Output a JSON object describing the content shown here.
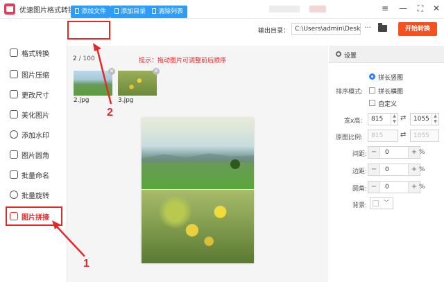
{
  "app": {
    "title": "优速图片格式转换器"
  },
  "sidebar": {
    "items": [
      {
        "label": "格式转换"
      },
      {
        "label": "图片压缩"
      },
      {
        "label": "更改尺寸"
      },
      {
        "label": "美化图片"
      },
      {
        "label": "添加水印"
      },
      {
        "label": "图片圆角"
      },
      {
        "label": "批量命名"
      },
      {
        "label": "批量旋转"
      },
      {
        "label": "图片拼接"
      }
    ]
  },
  "toolbar": {
    "add_file": "添加文件",
    "add_folder": "添加目录",
    "clear_list": "清除列表",
    "output_label": "输出目录：",
    "output_path": "C:\\Users\\admin\\Deskto",
    "dots": "···",
    "start": "开始转换"
  },
  "main": {
    "count": "2",
    "count_total": " / 100",
    "hint": "提示：拖动图片可调整前后顺序",
    "thumbs": [
      {
        "label": "2.jpg"
      },
      {
        "label": "3.jpg"
      }
    ]
  },
  "settings": {
    "title": "设置",
    "sort_label": "排序模式:",
    "options": [
      "拼长竖图",
      "拼长横图",
      "自定义"
    ],
    "selected_option": "拼长竖图",
    "wh_label": "宽x高:",
    "width": "815",
    "height": "1055",
    "ratio_label": "原图比例:",
    "ratio_w": "815",
    "ratio_h": "1055",
    "spacing_label": "间距:",
    "spacing": "0",
    "margin_label": "边距:",
    "margin": "0",
    "corner_label": "圆角:",
    "corner": "0",
    "percent": "%",
    "bg_label": "背景:"
  },
  "annotations": {
    "one": "1",
    "two": "2"
  },
  "colors": {
    "accent": "#2f9df6",
    "start": "#f4511e",
    "highlight": "#e02a2a"
  }
}
